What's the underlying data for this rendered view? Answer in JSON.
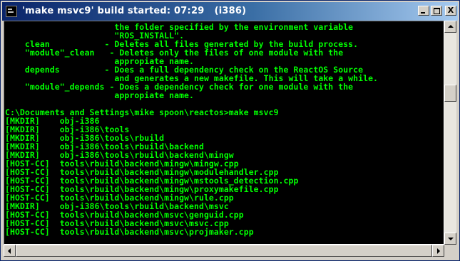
{
  "window": {
    "title": "'make msvc9' build started: 07:29   (i386)"
  },
  "titlebar_buttons": {
    "minimize": "",
    "maximize": "",
    "close": "X"
  },
  "console": {
    "lines": [
      "                      the folder specified by the environment variable",
      "                      \"ROS_INSTALL\".",
      "    clean           - Deletes all files generated by the build process.",
      "    \"module\"_clean   - Deletes only the files of one module with the",
      "                      appropiate name.",
      "    depends         - Does a full dependency check on the ReactOS Source",
      "                      and generates a new makefile. This will take a while.",
      "    \"module\"_depends - Does a dependency check for one module with the",
      "                      appropiate name.",
      "",
      "C:\\Documents and Settings\\mike spoon\\reactos>make msvc9",
      "[MKDIR]    obj-i386",
      "[MKDIR]    obj-i386\\tools",
      "[MKDIR]    obj-i386\\tools\\rbuild",
      "[MKDIR]    obj-i386\\tools\\rbuild\\backend",
      "[MKDIR]    obj-i386\\tools\\rbuild\\backend\\mingw",
      "[HOST-CC]  tools\\rbuild\\backend\\mingw\\mingw.cpp",
      "[HOST-CC]  tools\\rbuild\\backend\\mingw\\modulehandler.cpp",
      "[HOST-CC]  tools\\rbuild\\backend\\mingw\\mstools_detection.cpp",
      "[HOST-CC]  tools\\rbuild\\backend\\mingw\\proxymakefile.cpp",
      "[HOST-CC]  tools\\rbuild\\backend\\mingw\\rule.cpp",
      "[MKDIR]    obj-i386\\tools\\rbuild\\backend\\msvc",
      "[HOST-CC]  tools\\rbuild\\backend\\msvc\\genguid.cpp",
      "[HOST-CC]  tools\\rbuild\\backend\\msvc\\msvc.cpp",
      "[HOST-CC]  tools\\rbuild\\backend\\msvc\\projmaker.cpp"
    ]
  },
  "colors": {
    "console_bg": "#000000",
    "console_text": "#00ff00",
    "titlebar_start": "#0a246a",
    "titlebar_end": "#a6caf0"
  }
}
